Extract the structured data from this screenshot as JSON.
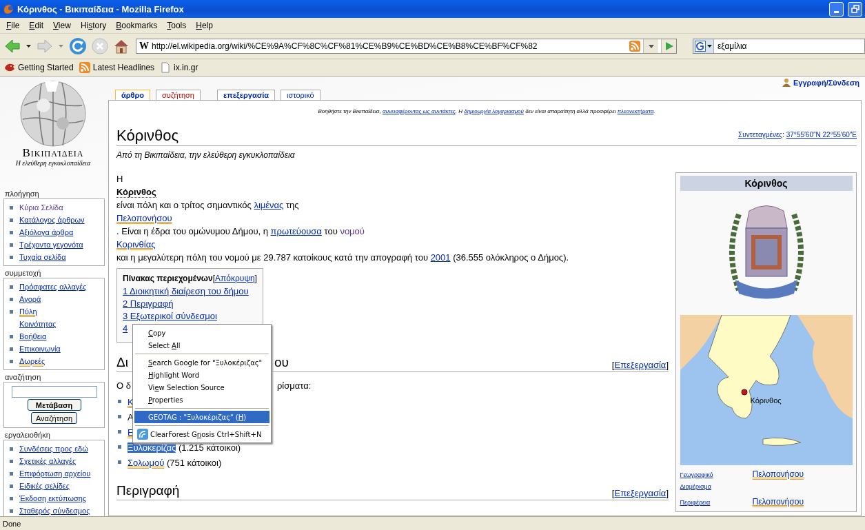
{
  "window": {
    "title": "Κόρινθος - Βικιπαίδεια - Mozilla Firefox"
  },
  "menubar": [
    {
      "key": "F",
      "after": "ile"
    },
    {
      "key": "E",
      "after": "dit"
    },
    {
      "key": "V",
      "after": "iew"
    },
    {
      "before": "Hi",
      "key": "s",
      "after": "tory"
    },
    {
      "key": "B",
      "after": "ookmarks"
    },
    {
      "key": "T",
      "after": "ools"
    },
    {
      "key": "H",
      "after": "elp"
    }
  ],
  "toolbar": {
    "favicon_letter": "W",
    "url": "http://el.wikipedia.org/wiki/%CE%9A%CF%8C%CF%81%CE%B9%CE%BD%CE%B8%CE%BF%CF%82",
    "search_value": "εξαμίλια"
  },
  "bookmarks": [
    {
      "label": "Getting Started",
      "kind": "firefox"
    },
    {
      "label": "Latest Headlines",
      "kind": "feed"
    },
    {
      "label": "ix.in.gr",
      "kind": "page"
    }
  ],
  "sidebar": {
    "logo_title": "Βικιπαίδεια",
    "logo_subtitle": "Η ελεύθερη εγκυκλοπαίδεια",
    "portlets": [
      {
        "title": "πλοήγηση",
        "items": [
          {
            "segments": [
              {
                "text": "Κύρια Σελίδα",
                "kind": "visited"
              }
            ]
          },
          {
            "segments": [
              {
                "text": "Κατάλογος άρθρων",
                "kind": "link"
              }
            ]
          },
          {
            "segments": [
              {
                "text": "Αξιόλογα άρθρα",
                "kind": "link"
              }
            ]
          },
          {
            "segments": [
              {
                "text": "Τρέχοντα γεγονότα",
                "kind": "link"
              }
            ]
          },
          {
            "segments": [
              {
                "text": "Τυχαία σελίδα",
                "kind": "link"
              }
            ]
          }
        ]
      },
      {
        "title": "συμμετοχή",
        "items": [
          {
            "segments": [
              {
                "text": "Πρόσφατες αλλαγές",
                "kind": "link"
              }
            ]
          },
          {
            "segments": [
              {
                "text": "Αγορά",
                "kind": "link"
              }
            ]
          },
          {
            "segments": [
              {
                "text": "Πύλη",
                "kind": "smartlink"
              },
              {
                "text": "Κοινότητας",
                "kind": "link"
              }
            ]
          },
          {
            "segments": [
              {
                "text": "Βοήθεια",
                "kind": "link"
              }
            ]
          },
          {
            "segments": [
              {
                "text": "Επικοινωνία",
                "kind": "link"
              }
            ]
          },
          {
            "segments": [
              {
                "text": "Δωρεές",
                "kind": "smartlink"
              }
            ]
          }
        ]
      }
    ],
    "search": {
      "title": "αναζήτηση",
      "go": "Μετάβαση",
      "search": "Αναζήτηση"
    },
    "toolbox": {
      "title": "εργαλειοθήκη",
      "items": [
        {
          "segments": [
            {
              "text": "Συνδέσεις προς εδώ",
              "kind": "link"
            }
          ]
        },
        {
          "segments": [
            {
              "text": "Σχετικές αλλαγές",
              "kind": "link"
            }
          ]
        },
        {
          "segments": [
            {
              "text": "Επιφόρτωση αρχείου",
              "kind": "link"
            }
          ]
        },
        {
          "segments": [
            {
              "text": "Ειδικές σελίδες",
              "kind": "link"
            }
          ]
        },
        {
          "segments": [
            {
              "text": "Έκδοση εκτύπωσης",
              "kind": "link"
            }
          ]
        },
        {
          "segments": [
            {
              "text": "Σταθερός σύνδεσμος",
              "kind": "link"
            }
          ]
        }
      ]
    }
  },
  "user_link": "Εγγραφή/Σύνδεση",
  "tabs": [
    {
      "label": "άρθρο",
      "selected": true,
      "missing": false
    },
    {
      "label": "συζήτηση",
      "selected": false,
      "missing": true
    },
    {
      "label": "επεξεργασία",
      "selected": false,
      "missing": false
    },
    {
      "label": "ιστορικό",
      "selected": false,
      "missing": false
    }
  ],
  "site_notice": [
    {
      "text": "Βοηθήστε την Βικιπαίδεια, ",
      "kind": "plain"
    },
    {
      "text": "συνεισφέροντας ως συντάκτες",
      "kind": "link"
    },
    {
      "text": ". Η ",
      "kind": "plain"
    },
    {
      "text": "δημιουργία λογαριασμού",
      "kind": "link"
    },
    {
      "text": " δεν είναι απαραίτητη αλλά προσφέρει ",
      "kind": "plain"
    },
    {
      "text": "πλεονεκτήματα",
      "kind": "link"
    },
    {
      "text": ".",
      "kind": "plain"
    }
  ],
  "coordinates": {
    "label": "Συντεταγμένες",
    "separator": ":",
    "value": "37°55′60″N 22°55′60″E"
  },
  "article": {
    "title": "Κόρινθος",
    "subtitle": "Από τη Βικιπαίδεια, την ελεύθερη εγκυκλοπαίδεια",
    "intro": [
      [
        {
          "text": "Η",
          "kind": "plain"
        }
      ],
      [
        {
          "text": "Κόρινθος",
          "kind": "bold"
        }
      ],
      [
        {
          "text": "είναι πόλη και ο τρίτος σημαντικός ",
          "kind": "plain"
        },
        {
          "text": "λιμένας",
          "kind": "link"
        },
        {
          "text": " της",
          "kind": "plain"
        }
      ],
      [
        {
          "text": "Πελοπονήσου",
          "kind": "smartlink"
        }
      ],
      [
        {
          "text": ". Είναι η έδρα του ομώνυμου Δήμου, η ",
          "kind": "plain"
        },
        {
          "text": "πρωτεύουσα",
          "kind": "link"
        },
        {
          "text": " του ",
          "kind": "plain"
        },
        {
          "text": "νομού",
          "kind": "visited"
        }
      ],
      [
        {
          "text": "Κορινθίας",
          "kind": "smartlink"
        }
      ],
      [
        {
          "text": "και η μεγαλύτερη πόλη του νομού με 29.787 κατοίκους κατά την απογραφή του ",
          "kind": "plain"
        },
        {
          "text": "2001",
          "kind": "link"
        },
        {
          "text": " (36.555 ολόκληρος ο Δήμος).",
          "kind": "plain"
        }
      ]
    ],
    "toc": {
      "title": "Πίνακας περιεχομένων",
      "hide_open": "[",
      "hide": "Απόκρυψη",
      "hide_close": "]",
      "items": [
        "1 Διοικητική διαίρεση του δήμου",
        "2 Περιγραφή",
        "3 Εξωτερικοί σύνδεσμοι",
        "4"
      ]
    },
    "section1": {
      "heading_start": "Δι",
      "heading_end": "ου",
      "edit_open": "[",
      "edit": "Επεξεργασία",
      "edit_close": "]",
      "text_start": "Ο δ",
      "text_end": "ρίσματα:",
      "list": [
        [
          {
            "text": "Κ",
            "kind": "smartlink"
          }
        ],
        [
          {
            "text": "Α",
            "kind": "plain"
          }
        ],
        [
          {
            "text": "Ε",
            "kind": "smartlink"
          }
        ],
        [
          {
            "text": "Ξυλοκερίζας",
            "kind": "selected"
          },
          {
            "text": " (1.215 κάτοικοι)",
            "kind": "plain"
          }
        ],
        [
          {
            "text": "Σολωμού",
            "kind": "smartlink"
          },
          {
            "text": " (751 κάτοικοι)",
            "kind": "plain"
          }
        ]
      ]
    },
    "section2": {
      "heading": "Περιγραφή",
      "edit_open": "[",
      "edit": "Επεξεργασία",
      "edit_close": "]"
    }
  },
  "infobox": {
    "title": "Κόρινθος",
    "map_label": "Κόρινθος",
    "rows": [
      {
        "label": "Γεωγραφικό Διαμέρισμα",
        "value": "Πελοπονήσου"
      },
      {
        "label": "Περιφέρεια",
        "value": "Πελοπονήσου"
      }
    ]
  },
  "context_menu": [
    {
      "kind": "item",
      "key": "C",
      "after": "opy",
      "selected": false
    },
    {
      "kind": "item",
      "before": "Select ",
      "key": "A",
      "after": "ll",
      "selected": false
    },
    {
      "kind": "separator"
    },
    {
      "kind": "item",
      "key": "S",
      "after": "earch Google for \"Ξυλοκέριζας\"",
      "selected": false
    },
    {
      "kind": "item",
      "key": "H",
      "after": "ighlight Word",
      "selected": false
    },
    {
      "kind": "item",
      "before": "Vi",
      "key": "e",
      "after": "w Selection Source",
      "selected": false
    },
    {
      "kind": "item",
      "key": "P",
      "after": "roperties",
      "selected": false
    },
    {
      "kind": "separator"
    },
    {
      "kind": "item",
      "before": "GEOTAG : \"Ξυλοκέριζας\" (",
      "key": "H",
      "after": ")",
      "selected": true
    },
    {
      "kind": "separator"
    },
    {
      "kind": "icon-item",
      "before": "ClearForest G",
      "key": "n",
      "after": "osis Ctrl+Shift+N",
      "selected": false
    }
  ],
  "status_bar": "Done"
}
